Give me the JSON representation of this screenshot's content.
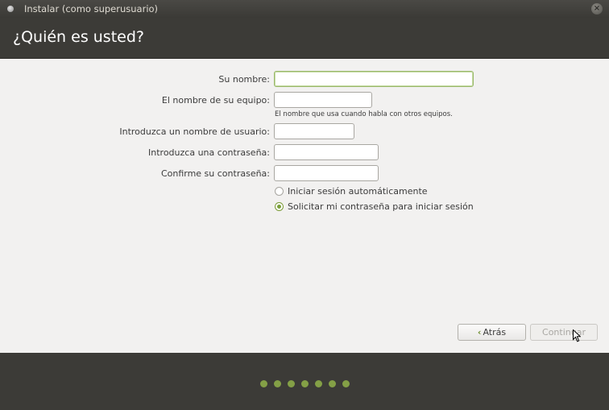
{
  "window": {
    "title": "Instalar (como superusuario)",
    "close_glyph": "×"
  },
  "header": {
    "title": "¿Quién es usted?"
  },
  "form": {
    "name_label": "Su nombre:",
    "name_value": "",
    "computer_label": "El nombre de su equipo:",
    "computer_value": "",
    "computer_hint": "El nombre que usa cuando habla con otros equipos.",
    "username_label": "Introduzca un nombre de usuario:",
    "username_value": "",
    "password_label": "Introduzca una contraseña:",
    "confirm_label": "Confirme su contraseña:"
  },
  "login_options": [
    {
      "label": "Iniciar sesión automáticamente",
      "selected": false
    },
    {
      "label": "Solicitar mi contraseña para iniciar sesión",
      "selected": true
    }
  ],
  "buttons": {
    "back_chevron": "‹",
    "back_label": "Atrás",
    "continue_label": "Continuar",
    "continue_enabled": false
  },
  "progress": {
    "total_steps": 7
  },
  "colors": {
    "accent": "#84a046",
    "header_bg": "#3c3b37",
    "content_bg": "#f2f1f0"
  }
}
